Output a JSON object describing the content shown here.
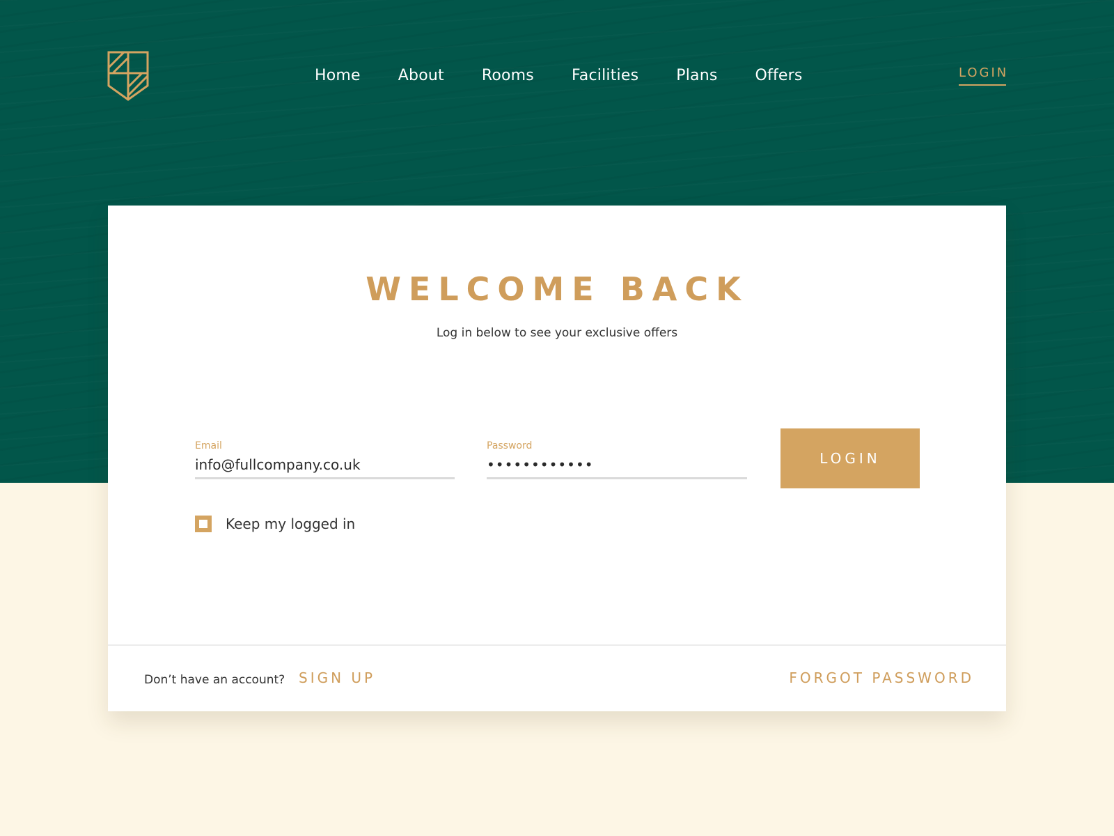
{
  "brand": {
    "logo_icon": "shield-logo-icon",
    "accent_color": "#d4a461",
    "hero_color": "#02564a"
  },
  "nav": {
    "items": [
      {
        "label": "Home"
      },
      {
        "label": "About"
      },
      {
        "label": "Rooms"
      },
      {
        "label": "Facilities"
      },
      {
        "label": "Plans"
      },
      {
        "label": "Offers"
      }
    ],
    "login_label": "LOGIN"
  },
  "card": {
    "title": "WELCOME BACK",
    "subtitle": "Log in below to see your exclusive offers",
    "email": {
      "label": "Email",
      "value": "info@fullcompany.co.uk"
    },
    "password": {
      "label": "Password",
      "value": "••••••••••••"
    },
    "login_button": "LOGIN",
    "keep_logged_in": {
      "label": "Keep my logged in",
      "checked": true
    },
    "footer": {
      "no_account_text": "Don’t have an account?",
      "sign_up": "SIGN UP",
      "forgot_password": "FORGOT PASSWORD"
    }
  }
}
